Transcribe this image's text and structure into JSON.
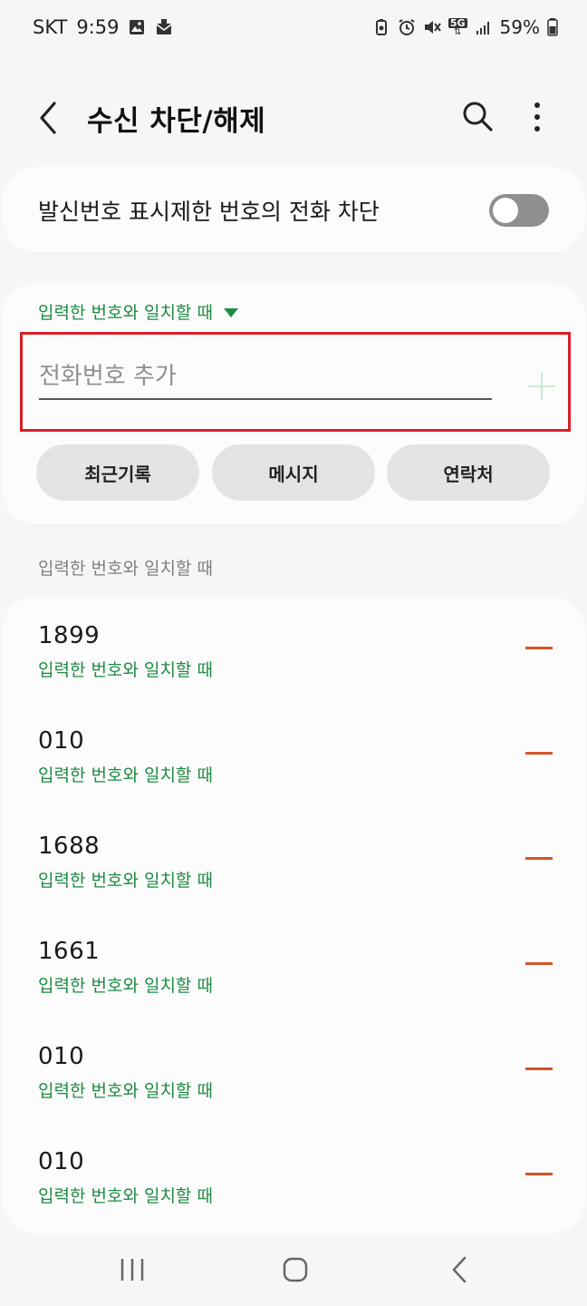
{
  "status_bar": {
    "carrier": "SKT",
    "time": "9:59",
    "network": "5G",
    "battery": "59%"
  },
  "header": {
    "title": "수신 차단/해제"
  },
  "toggle_setting": {
    "label": "발신번호 표시제한 번호의 전화 차단",
    "enabled": false
  },
  "add_number": {
    "match_rule": "입력한 번호와 일치할 때",
    "placeholder": "전화번호 추가",
    "value": "",
    "buttons": [
      "최근기록",
      "메시지",
      "연락처"
    ]
  },
  "blocked_list": {
    "section_label": "입력한 번호와 일치할 때",
    "items": [
      {
        "number": "1899",
        "rule": "입력한 번호와 일치할 때"
      },
      {
        "number": "010",
        "rule": "입력한 번호와 일치할 때"
      },
      {
        "number": "1688",
        "rule": "입력한 번호와 일치할 때"
      },
      {
        "number": "1661",
        "rule": "입력한 번호와 일치할 때"
      },
      {
        "number": "010",
        "rule": "입력한 번호와 일치할 때"
      },
      {
        "number": "010",
        "rule": "입력한 번호와 일치할 때"
      }
    ]
  },
  "icons": {
    "back": "back-arrow-icon",
    "search": "search-icon",
    "more": "more-vertical-icon",
    "add": "plus-icon",
    "remove": "minus-icon",
    "nav_recents": "recents-icon",
    "nav_home": "home-icon",
    "nav_back": "nav-back-icon"
  },
  "colors": {
    "accent_green": "#1e8a43",
    "remove_orange": "#d5542a",
    "highlight_red": "#d81f26"
  }
}
